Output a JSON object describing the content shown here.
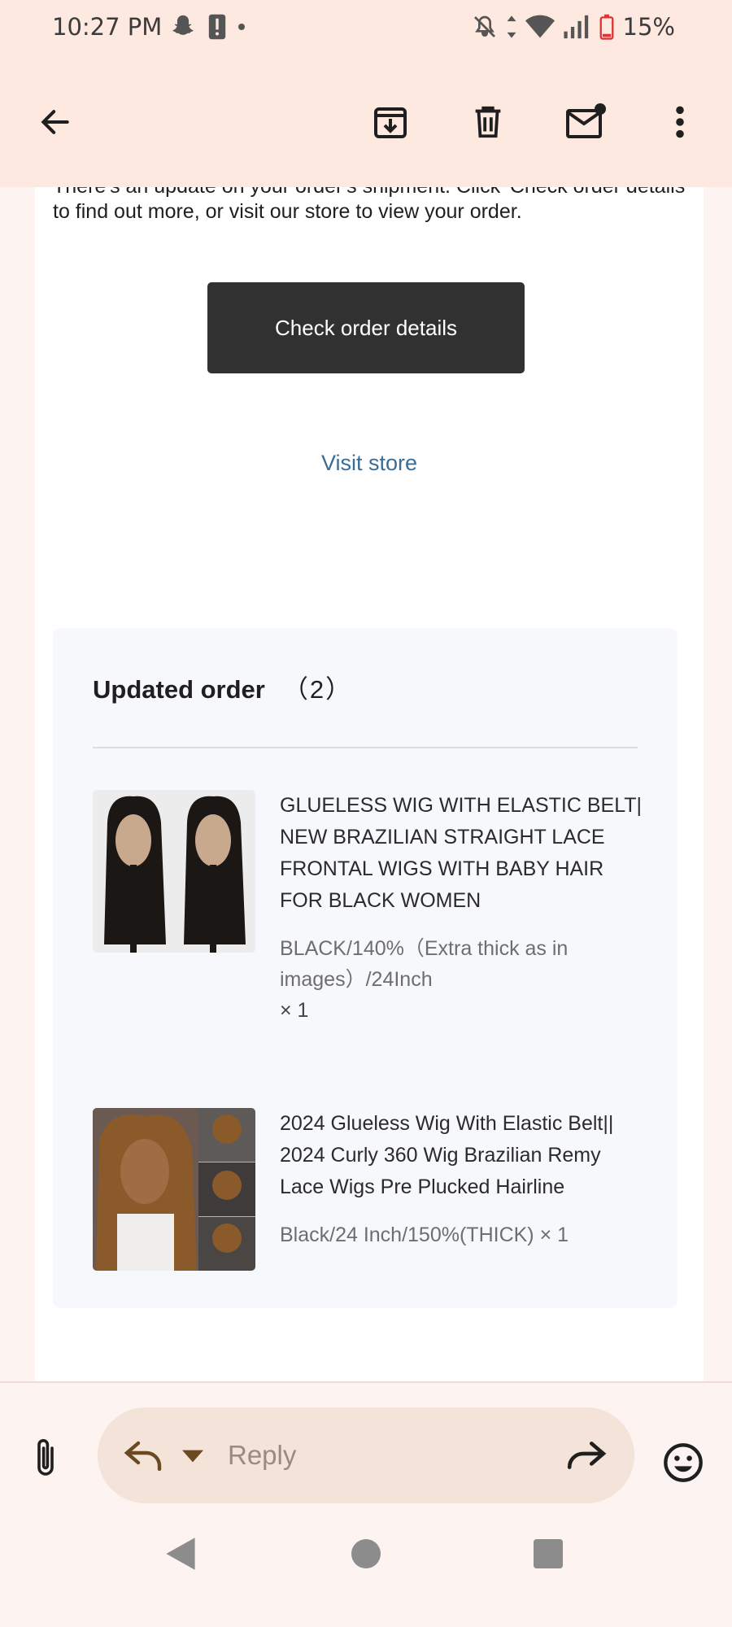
{
  "status_bar": {
    "time": "10:27 PM",
    "battery": "15%"
  },
  "toolbar": {
    "back": "back-arrow-icon",
    "archive": "archive-icon",
    "delete": "trash-icon",
    "mark_unread": "mark-unread-icon",
    "more": "more-vertical-icon"
  },
  "email": {
    "intro_text": "There's an update on your order's shipment. Click 'Check order details' to find out more, or visit our store to view your order.",
    "check_order_button": "Check order details",
    "visit_store_link": "Visit store",
    "order": {
      "title": "Updated order",
      "count": "（2）",
      "items": [
        {
          "name": "GLUELESS WIG WITH ELASTIC BELT| NEW BRAZILIAN STRAIGHT LACE FRONTAL WIGS WITH BABY HAIR FOR BLACK WOMEN",
          "variant": "BLACK/140%（Extra thick as in images）/24Inch",
          "quantity": "× 1"
        },
        {
          "name": "2024 Glueless Wig With Elastic Belt|| 2024 Curly 360 Wig Brazilian Remy Lace Wigs Pre Plucked Hairline",
          "variant": "Black/24 Inch/150%(THICK) × 1"
        }
      ]
    }
  },
  "reply_bar": {
    "placeholder": "Reply"
  },
  "colors": {
    "top_bar": "#fde9e0",
    "button_dark": "#323132",
    "link": "#3a6d96",
    "reply_pill": "#f4e3d8",
    "icon_brown": "#6b4a22"
  }
}
